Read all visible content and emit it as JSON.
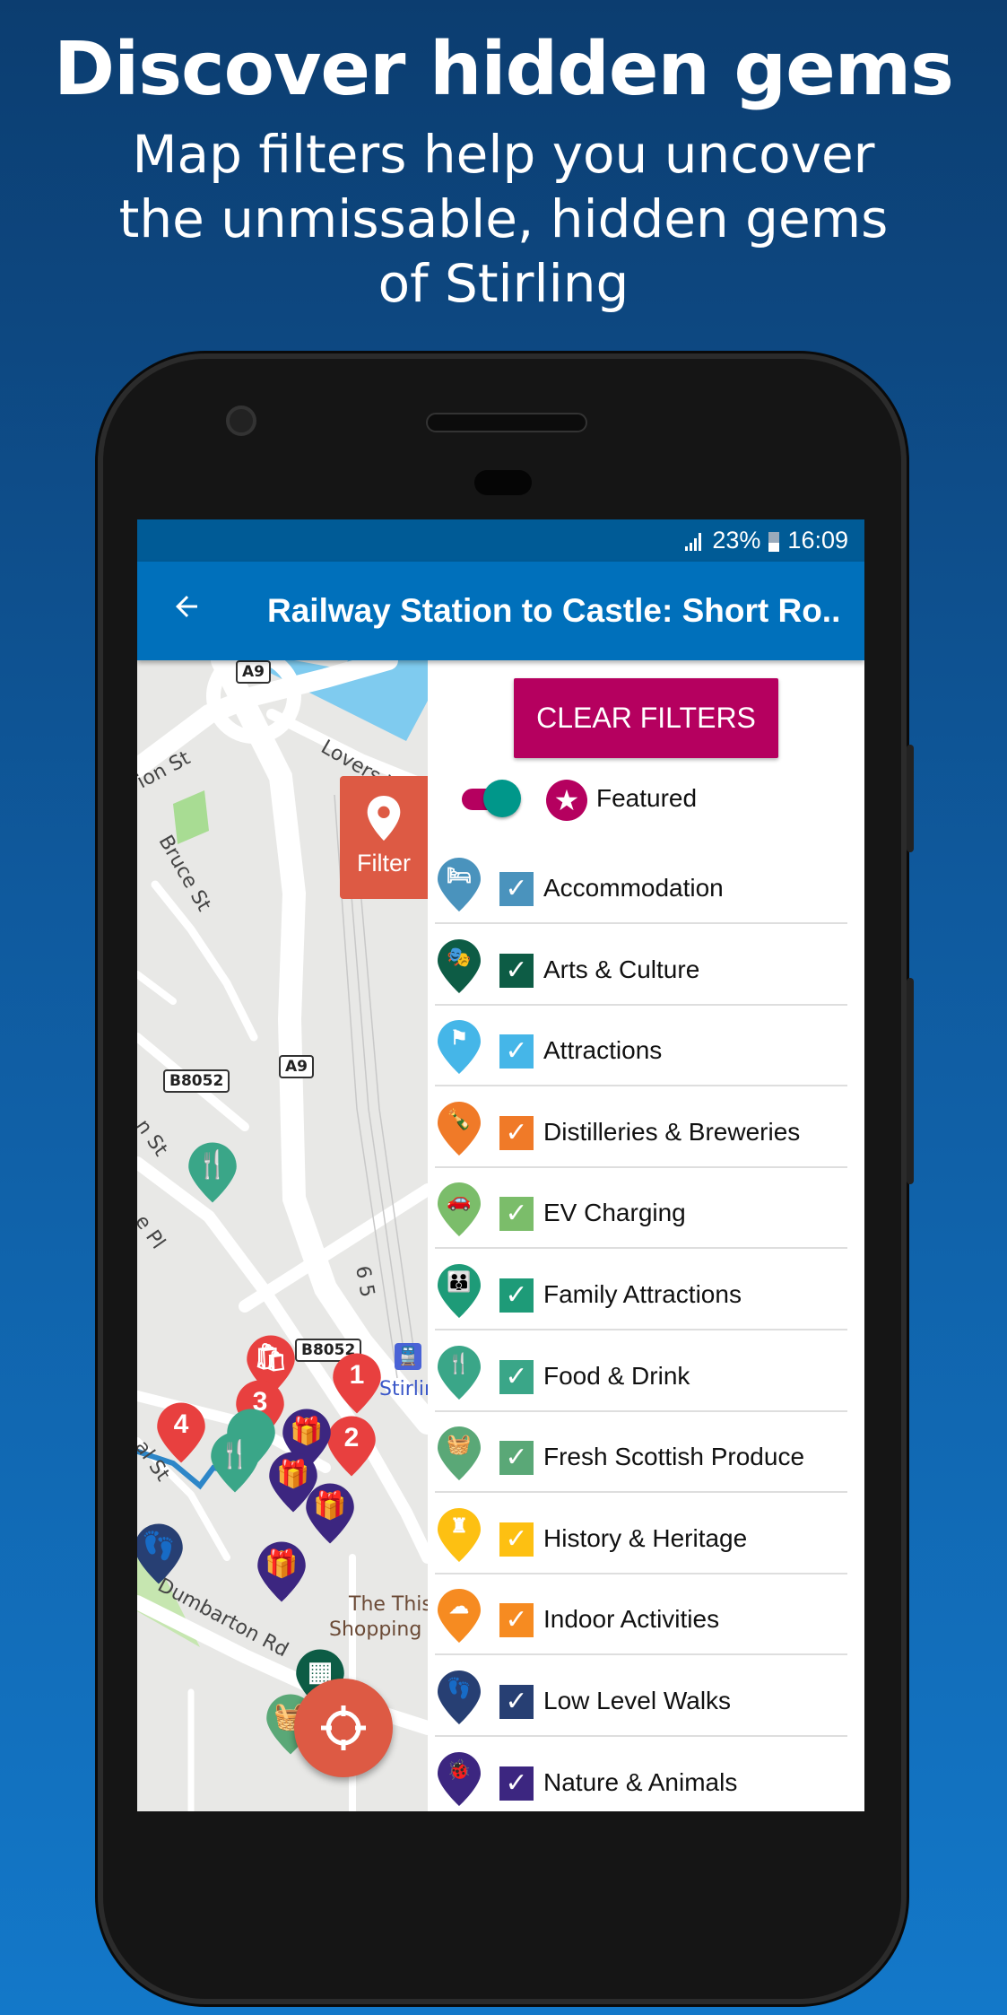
{
  "promo": {
    "title": "Discover hidden gems",
    "subtitle_lines": [
      "Map filters help you uncover",
      "the unmissable, hidden gems",
      "of Stirling"
    ]
  },
  "status_bar": {
    "signal_icon": "signal-icon",
    "battery": "23%",
    "battery_icon": "battery-icon",
    "time": "16:09"
  },
  "app_bar": {
    "back_icon": "arrow-left-icon",
    "title": "Railway Station to Castle: Short Ro.."
  },
  "map": {
    "filter_tab_label": "Filter",
    "labels": {
      "a9_top": "A9",
      "a9_mid": "A9",
      "b8052_left": "B8052",
      "b8052_mid": "B8052",
      "ion_st": "ion St",
      "lovers": "Lovers W",
      "bruce_st": "Bruce St",
      "n_st": "n St",
      "e_pl": "e Pl",
      "rail": "6 5",
      "stirling": "Stirling",
      "al_st": "al St",
      "dumbarton": "Dumbarton Rd",
      "thistles_1": "The Thist",
      "thistles_2": "Shopping C"
    },
    "route_markers": [
      "1",
      "2",
      "3",
      "4"
    ],
    "locate_button_icon": "crosshair-icon"
  },
  "filters": {
    "clear_label": "CLEAR FILTERS",
    "featured": {
      "label": "Featured",
      "enabled": true,
      "icon": "star-icon"
    },
    "categories": [
      {
        "label": "Accommodation",
        "color": "#4a93bd",
        "checked": true,
        "icon": "bed-icon",
        "glyph": "🛏"
      },
      {
        "label": "Arts & Culture",
        "color": "#0d5c45",
        "checked": true,
        "icon": "theatre-masks-icon",
        "glyph": "🎭"
      },
      {
        "label": "Attractions",
        "color": "#45b6e8",
        "checked": true,
        "icon": "flag-icon",
        "glyph": "⚑"
      },
      {
        "label": "Distilleries & Breweries",
        "color": "#f07a28",
        "checked": true,
        "icon": "bottle-icon",
        "glyph": "🍾"
      },
      {
        "label": "EV Charging",
        "color": "#7bbd6a",
        "checked": true,
        "icon": "car-charging-icon",
        "glyph": "🚗"
      },
      {
        "label": "Family Attractions",
        "color": "#1e9b78",
        "checked": true,
        "icon": "family-icon",
        "glyph": "👪"
      },
      {
        "label": "Food & Drink",
        "color": "#3aa688",
        "checked": true,
        "icon": "fork-knife-icon",
        "glyph": "🍴"
      },
      {
        "label": "Fresh Scottish Produce",
        "color": "#5aa877",
        "checked": true,
        "icon": "basket-icon",
        "glyph": "🧺"
      },
      {
        "label": "History & Heritage",
        "color": "#fdc012",
        "checked": true,
        "icon": "castle-icon",
        "glyph": "♜"
      },
      {
        "label": "Indoor Activities",
        "color": "#f68b21",
        "checked": true,
        "icon": "rain-cloud-icon",
        "glyph": "☁"
      },
      {
        "label": "Low Level Walks",
        "color": "#273f73",
        "checked": true,
        "icon": "footprints-icon",
        "glyph": "👣"
      },
      {
        "label": "Nature & Animals",
        "color": "#3c2680",
        "checked": true,
        "icon": "ladybird-icon",
        "glyph": "🐞"
      }
    ]
  }
}
